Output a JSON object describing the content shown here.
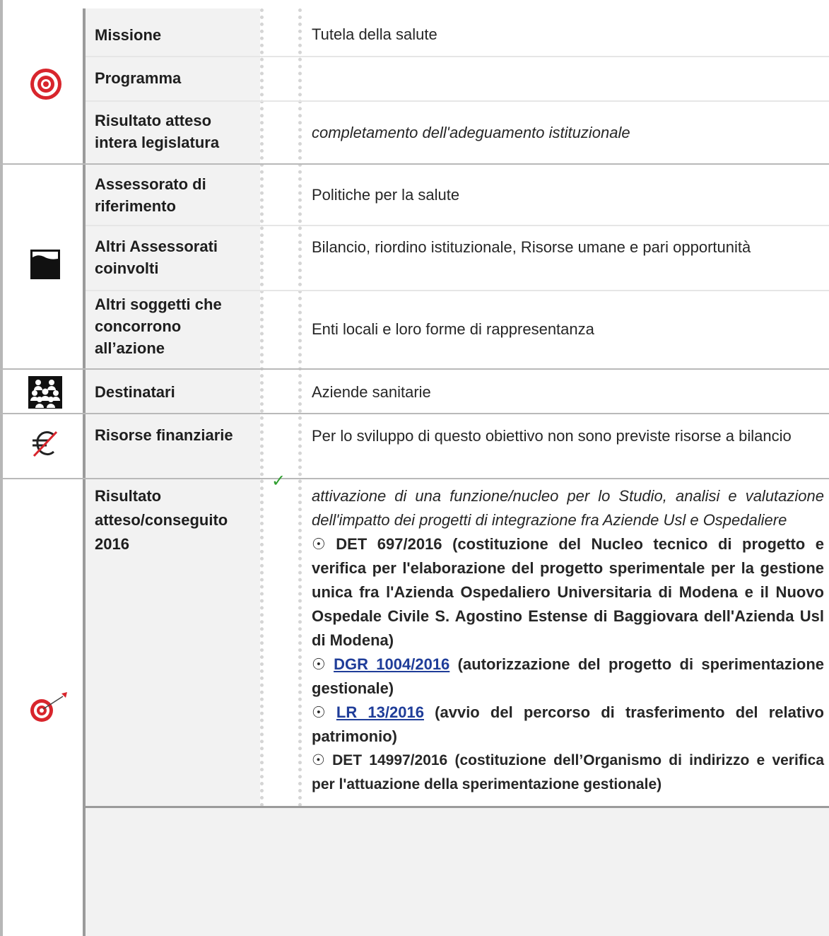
{
  "rows": {
    "missione": {
      "label": "Missione",
      "value": "Tutela della salute"
    },
    "programma": {
      "label": "Programma",
      "value": ""
    },
    "risultato_legislatura": {
      "label": "Risultato atteso intera legislatura",
      "value": "completamento dell'adeguamento istituzionale"
    },
    "assessorato": {
      "label": "Assessorato di riferimento",
      "value": "Politiche per la salute"
    },
    "altri_assessorati": {
      "label": "Altri Assessorati coinvolti",
      "value": "Bilancio, riordino istituzionale, Risorse umane e pari opportunità"
    },
    "altri_soggetti": {
      "label": "Altri soggetti che concorrono all’azione",
      "value": "Enti locali e loro forme di rappresentanza"
    },
    "destinatari": {
      "label": "Destinatari",
      "value": "Aziende sanitarie"
    },
    "risorse": {
      "label": "Risorse finanziarie",
      "value": "Per lo sviluppo di questo obiettivo non sono previste risorse a bilancio"
    },
    "risultato_2016": {
      "label": "Risultato atteso/conseguito 2016",
      "intro": "attivazione di una funzione/nucleo per lo Studio, analisi e valutazione dell'impatto dei progetti di integrazione fra Aziende Usl e Ospedaliere",
      "bullet_symbol": "☉",
      "items": [
        {
          "link": "",
          "text": "DET 697/2016 (costituzione del Nucleo tecnico di progetto e verifica per l'elaborazione del progetto sperimentale per la gestione unica fra l'Azienda Ospedaliero Universitaria di Modena e il Nuovo Ospedale Civile S. Agostino Estense di Baggiovara dell'Azienda Usl di Modena)"
        },
        {
          "link": "DGR 1004/2016",
          "text": "(autorizzazione del progetto di sperimentazione gestionale)"
        },
        {
          "link": "LR 13/2016",
          "text": "(avvio del percorso di trasferimento del relativo patrimonio)"
        },
        {
          "link": "",
          "text": "DET 14997/2016 (costituzione dell’Organismo di indirizzo e verifica per l'attuazione della sperimentazione gestionale)"
        }
      ],
      "status": "✓"
    }
  },
  "icons": {
    "target": "target-icon",
    "landscape": "landscape-icon",
    "people": "people-group-icon",
    "no_euro": "no-euro-icon",
    "dart": "dart-target-icon"
  },
  "colors": {
    "target_red": "#d8252c",
    "check_green": "#2e9e2e",
    "link_blue": "#1f3d99"
  }
}
